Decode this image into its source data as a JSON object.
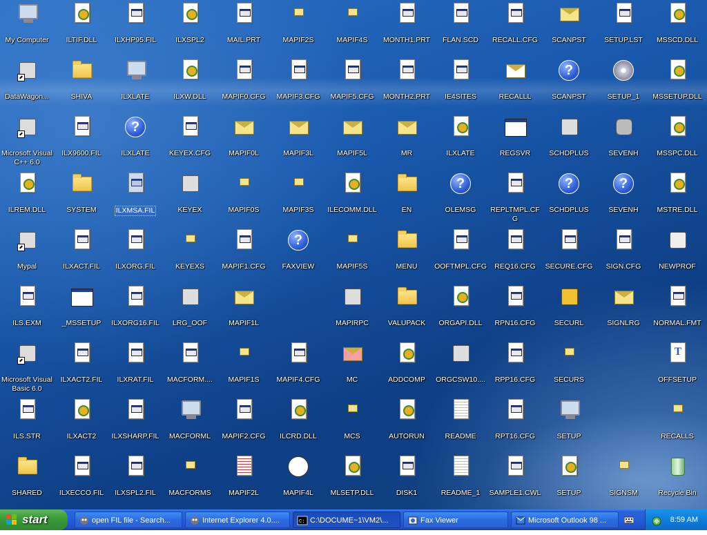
{
  "desktop": {
    "icons": [
      {
        "label": "My Computer",
        "icon": "computer-icon",
        "col": 0,
        "row": 0
      },
      {
        "label": "DataWagon...",
        "icon": "network-icon",
        "col": 0,
        "row": 1,
        "shortcut": true
      },
      {
        "label": "Microsoft Visual C++ 6.0",
        "icon": "vc-icon",
        "col": 0,
        "row": 2,
        "shortcut": true
      },
      {
        "label": "ILREM.DLL",
        "icon": "dll-icon",
        "col": 0,
        "row": 3
      },
      {
        "label": "Mypal",
        "icon": "raccoon-icon",
        "col": 0,
        "row": 4,
        "shortcut": true
      },
      {
        "label": "ILS.EXM",
        "icon": "file-icon",
        "col": 0,
        "row": 5
      },
      {
        "label": "Microsoft Visual Basic 6.0",
        "icon": "vb-icon",
        "col": 0,
        "row": 6,
        "shortcut": true
      },
      {
        "label": "ILS.STR",
        "icon": "file-icon",
        "col": 0,
        "row": 7
      },
      {
        "label": "SHARED",
        "icon": "folder-icon",
        "col": 0,
        "row": 8
      },
      {
        "label": "ILTIF.DLL",
        "icon": "dll-icon",
        "col": 1,
        "row": 0
      },
      {
        "label": "SHIVA",
        "icon": "folder-icon",
        "col": 1,
        "row": 1
      },
      {
        "label": "ILX9600.FIL",
        "icon": "file-icon",
        "col": 1,
        "row": 2
      },
      {
        "label": "SYSTEM",
        "icon": "folder-icon",
        "col": 1,
        "row": 3
      },
      {
        "label": "ILXACT.FIL",
        "icon": "file-icon",
        "col": 1,
        "row": 4
      },
      {
        "label": "_MSSETUP",
        "icon": "window-icon",
        "col": 1,
        "row": 5
      },
      {
        "label": "ILXACT2.FIL",
        "icon": "file-icon",
        "col": 1,
        "row": 6
      },
      {
        "label": "ILXACT2",
        "icon": "config-icon",
        "col": 1,
        "row": 7
      },
      {
        "label": "ILXECCO.FIL",
        "icon": "file-icon",
        "col": 1,
        "row": 8
      },
      {
        "label": "ILXHP95.FIL",
        "icon": "file-icon",
        "col": 2,
        "row": 0
      },
      {
        "label": "ILXLATE",
        "icon": "computer-icon",
        "col": 2,
        "row": 1
      },
      {
        "label": "ILXLATE",
        "icon": "help-icon",
        "col": 2,
        "row": 2
      },
      {
        "label": "ILXMSA.FIL",
        "icon": "file-icon",
        "col": 2,
        "row": 3,
        "selected": true
      },
      {
        "label": "ILXORG.FIL",
        "icon": "file-icon",
        "col": 2,
        "row": 4
      },
      {
        "label": "ILXORG16.FIL",
        "icon": "file-icon",
        "col": 2,
        "row": 5
      },
      {
        "label": "ILXRAT.FIL",
        "icon": "file-icon",
        "col": 2,
        "row": 6
      },
      {
        "label": "ILXSHARP.FIL",
        "icon": "file-icon",
        "col": 2,
        "row": 7
      },
      {
        "label": "ILXSPL2.FIL",
        "icon": "file-icon",
        "col": 2,
        "row": 8
      },
      {
        "label": "ILXSPL2",
        "icon": "config-icon",
        "col": 3,
        "row": 0
      },
      {
        "label": "ILXW.DLL",
        "icon": "dll-icon",
        "col": 3,
        "row": 1
      },
      {
        "label": "KEYEX.CFG",
        "icon": "file-icon",
        "col": 3,
        "row": 2
      },
      {
        "label": "KEYEX",
        "icon": "key-icon",
        "col": 3,
        "row": 3
      },
      {
        "label": "KEYEXS",
        "icon": "small-key-icon",
        "col": 3,
        "row": 4
      },
      {
        "label": "LRG_OOF",
        "icon": "door-icon",
        "col": 3,
        "row": 5
      },
      {
        "label": "MACFORM....",
        "icon": "file-icon",
        "col": 3,
        "row": 6
      },
      {
        "label": "MACFORML",
        "icon": "mac-icon",
        "col": 3,
        "row": 7
      },
      {
        "label": "MACFORMS",
        "icon": "small-mac-icon",
        "col": 3,
        "row": 8
      },
      {
        "label": "MAIL.PRT",
        "icon": "file-icon",
        "col": 4,
        "row": 0
      },
      {
        "label": "MAPIF0.CFG",
        "icon": "file-icon",
        "col": 4,
        "row": 1
      },
      {
        "label": "MAPIF0L",
        "icon": "envelope-icon",
        "col": 4,
        "row": 2
      },
      {
        "label": "MAPIF0S",
        "icon": "small-envelope-icon",
        "col": 4,
        "row": 3
      },
      {
        "label": "MAPIF1.CFG",
        "icon": "file-icon",
        "col": 4,
        "row": 4
      },
      {
        "label": "MAPIF1L",
        "icon": "envelope-icon",
        "col": 4,
        "row": 5
      },
      {
        "label": "MAPIF1S",
        "icon": "small-envelope-icon",
        "col": 4,
        "row": 6
      },
      {
        "label": "MAPIF2.CFG",
        "icon": "file-icon",
        "col": 4,
        "row": 7
      },
      {
        "label": "MAPIF2L",
        "icon": "document-icon",
        "col": 4,
        "row": 8
      },
      {
        "label": "MAPIF2S",
        "icon": "small-doc-icon",
        "col": 5,
        "row": 0
      },
      {
        "label": "MAPIF3.CFG",
        "icon": "file-icon",
        "col": 5,
        "row": 1
      },
      {
        "label": "MAPIF3L",
        "icon": "pen-envelope-icon",
        "col": 5,
        "row": 2
      },
      {
        "label": "MAPIF3S",
        "icon": "small-envelope-icon",
        "col": 5,
        "row": 3
      },
      {
        "label": "FAXVIEW",
        "icon": "help-icon",
        "col": 5,
        "row": 4
      },
      {
        "label": "MAPIF4.CFG",
        "icon": "file-icon",
        "col": 5,
        "row": 6
      },
      {
        "label": "ILCRD.DLL",
        "icon": "dll-icon",
        "col": 5,
        "row": 7
      },
      {
        "label": "MAPIF4L",
        "icon": "ball-icon",
        "col": 5,
        "row": 8
      },
      {
        "label": "MAPIF4S",
        "icon": "small-ball-icon",
        "col": 6,
        "row": 0
      },
      {
        "label": "MAPIF5.CFG",
        "icon": "file-icon",
        "col": 6,
        "row": 1
      },
      {
        "label": "MAPIF5L",
        "icon": "envelope-icon",
        "col": 6,
        "row": 2
      },
      {
        "label": "ILECOMM.DLL",
        "icon": "dll-icon",
        "col": 6,
        "row": 3
      },
      {
        "label": "MAPIF5S",
        "icon": "small-envelope-icon",
        "col": 6,
        "row": 4
      },
      {
        "label": "MAPIRPC",
        "icon": "rpc-icon",
        "col": 6,
        "row": 5
      },
      {
        "label": "MC",
        "icon": "no-mail-icon",
        "col": 6,
        "row": 6
      },
      {
        "label": "MCS",
        "icon": "small-no-mail-icon",
        "col": 6,
        "row": 7
      },
      {
        "label": "MLSETP.DLL",
        "icon": "dll-icon",
        "col": 6,
        "row": 8
      },
      {
        "label": "MONTH1.PRT",
        "icon": "file-icon",
        "col": 7,
        "row": 0
      },
      {
        "label": "MONTH2.PRT",
        "icon": "file-icon",
        "col": 7,
        "row": 1
      },
      {
        "label": "MR",
        "icon": "clock-envelope-icon",
        "col": 7,
        "row": 2
      },
      {
        "label": "EN",
        "icon": "folder-icon",
        "col": 7,
        "row": 3
      },
      {
        "label": "MENU",
        "icon": "folder-icon",
        "col": 7,
        "row": 4
      },
      {
        "label": "VALUPACK",
        "icon": "folder-icon",
        "col": 7,
        "row": 5
      },
      {
        "label": "ADDCOMP",
        "icon": "config-icon",
        "col": 7,
        "row": 6
      },
      {
        "label": "AUTORUN",
        "icon": "config-icon",
        "col": 7,
        "row": 7
      },
      {
        "label": "DISK1",
        "icon": "file-icon",
        "col": 7,
        "row": 8
      },
      {
        "label": "FLAN.SCD",
        "icon": "file-icon",
        "col": 8,
        "row": 0
      },
      {
        "label": "IE4SITES",
        "icon": "file-icon",
        "col": 8,
        "row": 1
      },
      {
        "label": "ILXLATE",
        "icon": "config-icon",
        "col": 8,
        "row": 2
      },
      {
        "label": "OLEMSG",
        "icon": "help-icon",
        "col": 8,
        "row": 3
      },
      {
        "label": "OOFTMPL.CFG",
        "icon": "file-icon",
        "col": 8,
        "row": 4
      },
      {
        "label": "ORGAPI.DLL",
        "icon": "dll-icon",
        "col": 8,
        "row": 5
      },
      {
        "label": "ORGCSW10....",
        "icon": "generic-icon",
        "col": 8,
        "row": 6
      },
      {
        "label": "README",
        "icon": "text-icon",
        "col": 8,
        "row": 7
      },
      {
        "label": "README_1",
        "icon": "text-icon",
        "col": 8,
        "row": 8
      },
      {
        "label": "RECALL.CFG",
        "icon": "file-icon",
        "col": 9,
        "row": 0
      },
      {
        "label": "RECALLL",
        "icon": "recall-icon",
        "col": 9,
        "row": 1
      },
      {
        "label": "REGSVR",
        "icon": "window-icon",
        "col": 9,
        "row": 2
      },
      {
        "label": "REPLTMPL.CFG",
        "icon": "file-icon",
        "col": 9,
        "row": 3
      },
      {
        "label": "REQ16.CFG",
        "icon": "file-icon",
        "col": 9,
        "row": 4
      },
      {
        "label": "RPN16.CFG",
        "icon": "file-icon",
        "col": 9,
        "row": 5
      },
      {
        "label": "RPP16.CFG",
        "icon": "file-icon",
        "col": 9,
        "row": 6
      },
      {
        "label": "RPT16.CFG",
        "icon": "file-icon",
        "col": 9,
        "row": 7
      },
      {
        "label": "SAMPLE1.CWL",
        "icon": "file-icon",
        "col": 9,
        "row": 8
      },
      {
        "label": "SCANPST",
        "icon": "scanpst-icon",
        "col": 10,
        "row": 0
      },
      {
        "label": "SCANPST",
        "icon": "help-icon",
        "col": 10,
        "row": 1
      },
      {
        "label": "SCHDPLUS",
        "icon": "schedule-icon",
        "col": 10,
        "row": 2
      },
      {
        "label": "SCHDPLUS",
        "icon": "help-icon",
        "col": 10,
        "row": 3
      },
      {
        "label": "SECURE.CFG",
        "icon": "file-icon",
        "col": 10,
        "row": 4
      },
      {
        "label": "SECURL",
        "icon": "lock-icon",
        "col": 10,
        "row": 5
      },
      {
        "label": "SECURS",
        "icon": "small-lock-icon",
        "col": 10,
        "row": 6
      },
      {
        "label": "SETUP",
        "icon": "setup-icon",
        "col": 10,
        "row": 7
      },
      {
        "label": "SETUP",
        "icon": "config-icon",
        "col": 10,
        "row": 8
      },
      {
        "label": "SETUP.LST",
        "icon": "file-icon",
        "col": 11,
        "row": 0
      },
      {
        "label": "SETUP_1",
        "icon": "cd-icon",
        "col": 11,
        "row": 1
      },
      {
        "label": "SEVENH",
        "icon": "gray-icon",
        "col": 11,
        "row": 2
      },
      {
        "label": "SEVENH",
        "icon": "help-icon",
        "col": 11,
        "row": 3
      },
      {
        "label": "SIGN.CFG",
        "icon": "file-icon",
        "col": 11,
        "row": 4
      },
      {
        "label": "SIGNLRG",
        "icon": "pen-envelope-icon",
        "col": 11,
        "row": 5
      },
      {
        "label": "SIGNSM",
        "icon": "small-envelope-icon",
        "col": 11,
        "row": 8
      },
      {
        "label": "MSSCD.DLL",
        "icon": "dll-icon",
        "col": 12,
        "row": 0
      },
      {
        "label": "MSSETUP.DLL",
        "icon": "dll-icon",
        "col": 12,
        "row": 1
      },
      {
        "label": "MSSPC.DLL",
        "icon": "dll-icon",
        "col": 12,
        "row": 2
      },
      {
        "label": "MSTRE.DLL",
        "icon": "dll-icon",
        "col": 12,
        "row": 3
      },
      {
        "label": "NEWPROF",
        "icon": "briefcase-icon",
        "col": 12,
        "row": 4
      },
      {
        "label": "NORMAL.FMT",
        "icon": "file-icon",
        "col": 12,
        "row": 5
      },
      {
        "label": "OFFSETUP",
        "icon": "font-icon",
        "col": 12,
        "row": 6
      },
      {
        "label": "RECALLS",
        "icon": "small-recall-icon",
        "col": 12,
        "row": 7
      },
      {
        "label": "Recycle Bin",
        "icon": "recycle-bin-icon",
        "col": 12,
        "row": 8
      }
    ]
  },
  "taskbar": {
    "start_label": "start",
    "tasks": [
      {
        "label": "open FIL file - Search...",
        "icon": "raccoon-icon",
        "active": false
      },
      {
        "label": "Internet Explorer 4.0....",
        "icon": "raccoon-icon",
        "active": false
      },
      {
        "label": "C:\\DOCUME~1\\VM2\\...",
        "icon": "cmd-icon",
        "active": true
      },
      {
        "label": "Fax Viewer",
        "icon": "fax-icon",
        "active": false
      },
      {
        "label": "Microsoft Outlook 98 ...",
        "icon": "outlook-icon",
        "active": false
      }
    ],
    "clock": "8:59 AM"
  }
}
